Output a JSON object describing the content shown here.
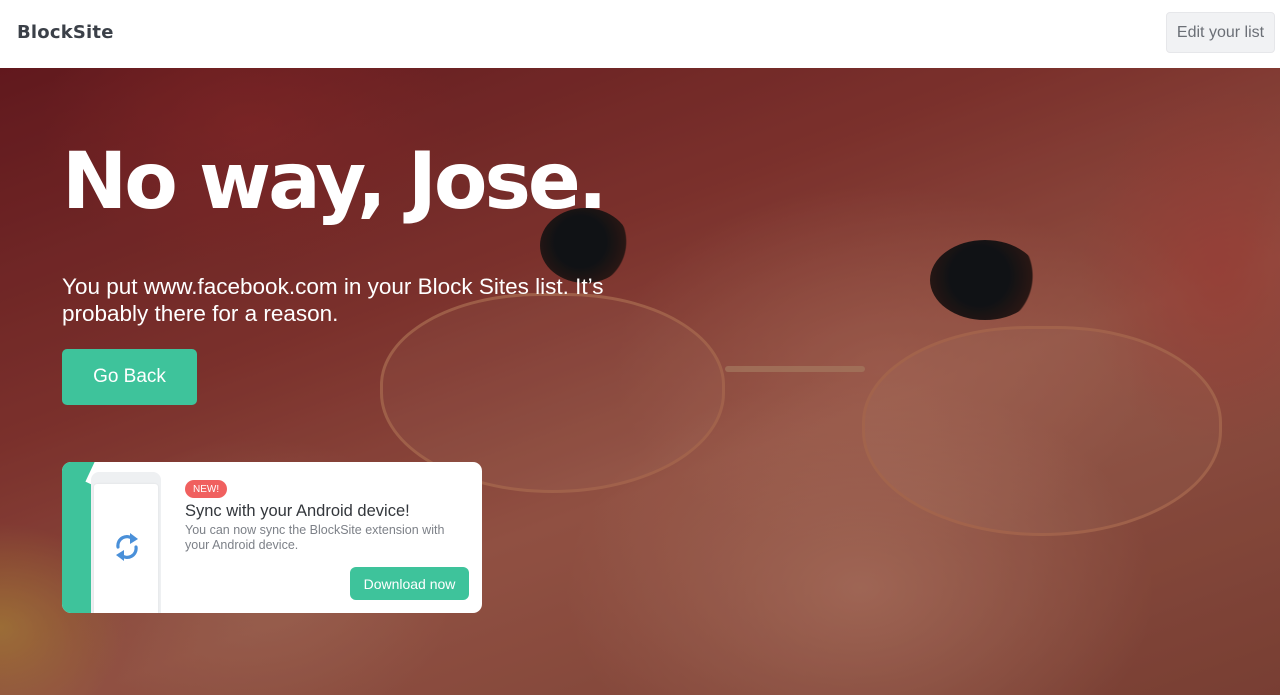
{
  "header": {
    "logo": "BlockSite",
    "edit_label": "Edit your list"
  },
  "hero": {
    "title": "No way, Jose.",
    "subtitle": "You put www.facebook.com in your Block Sites list. It’s probably there for a reason.",
    "go_back_label": "Go Back"
  },
  "promo": {
    "badge": "NEW!",
    "title": "Sync with your Android device!",
    "description": "You can now sync the BlockSite extension with your Android device.",
    "download_label": "Download now",
    "icon": "sync-icon"
  },
  "colors": {
    "accent": "#3ec39b",
    "badge": "#f0605f"
  }
}
